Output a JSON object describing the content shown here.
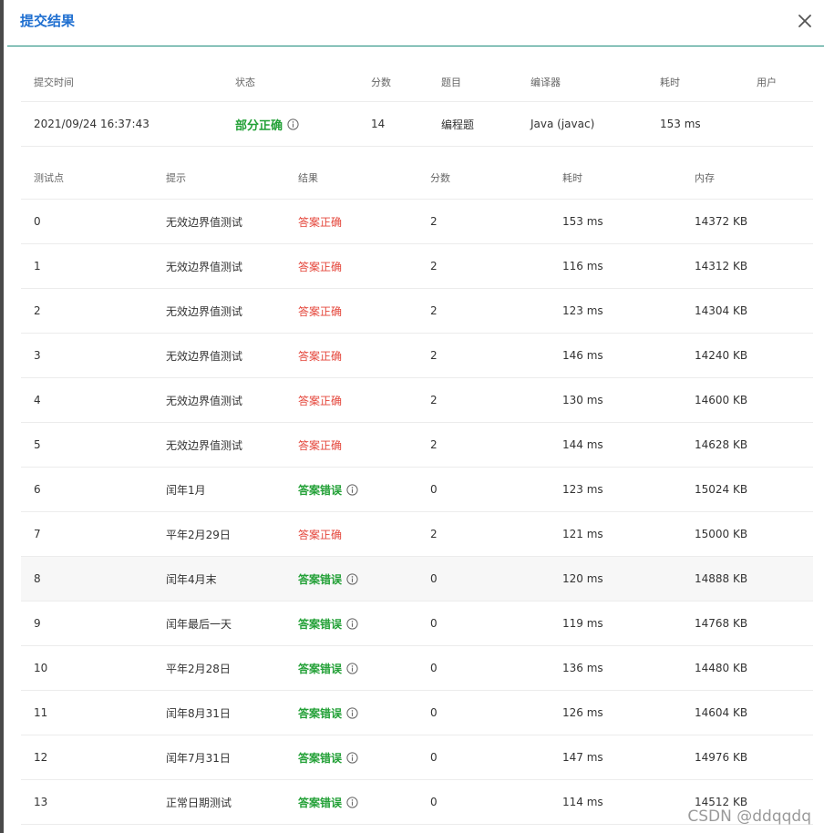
{
  "dialog": {
    "title": "提交结果"
  },
  "summary": {
    "headers": [
      "提交时间",
      "状态",
      "分数",
      "题目",
      "编译器",
      "耗时",
      "用户"
    ],
    "row": {
      "time": "2021/09/24 16:37:43",
      "status": "部分正确",
      "score": "14",
      "problem": "编程题",
      "compiler": "Java (javac)",
      "duration": "153 ms",
      "user": ""
    }
  },
  "tests": {
    "headers": [
      "测试点",
      "提示",
      "结果",
      "分数",
      "耗时",
      "内存"
    ],
    "rows": [
      {
        "id": "0",
        "hint": "无效边界值测试",
        "result": "答案正确",
        "ok": true,
        "score": "2",
        "time": "153 ms",
        "mem": "14372 KB"
      },
      {
        "id": "1",
        "hint": "无效边界值测试",
        "result": "答案正确",
        "ok": true,
        "score": "2",
        "time": "116 ms",
        "mem": "14312 KB"
      },
      {
        "id": "2",
        "hint": "无效边界值测试",
        "result": "答案正确",
        "ok": true,
        "score": "2",
        "time": "123 ms",
        "mem": "14304 KB"
      },
      {
        "id": "3",
        "hint": "无效边界值测试",
        "result": "答案正确",
        "ok": true,
        "score": "2",
        "time": "146 ms",
        "mem": "14240 KB"
      },
      {
        "id": "4",
        "hint": "无效边界值测试",
        "result": "答案正确",
        "ok": true,
        "score": "2",
        "time": "130 ms",
        "mem": "14600 KB"
      },
      {
        "id": "5",
        "hint": "无效边界值测试",
        "result": "答案正确",
        "ok": true,
        "score": "2",
        "time": "144 ms",
        "mem": "14628 KB"
      },
      {
        "id": "6",
        "hint": "闰年1月",
        "result": "答案错误",
        "ok": false,
        "score": "0",
        "time": "123 ms",
        "mem": "15024 KB"
      },
      {
        "id": "7",
        "hint": "平年2月29日",
        "result": "答案正确",
        "ok": true,
        "score": "2",
        "time": "121 ms",
        "mem": "15000 KB"
      },
      {
        "id": "8",
        "hint": "闰年4月末",
        "result": "答案错误",
        "ok": false,
        "score": "0",
        "time": "120 ms",
        "mem": "14888 KB"
      },
      {
        "id": "9",
        "hint": "闰年最后一天",
        "result": "答案错误",
        "ok": false,
        "score": "0",
        "time": "119 ms",
        "mem": "14768 KB"
      },
      {
        "id": "10",
        "hint": "平年2月28日",
        "result": "答案错误",
        "ok": false,
        "score": "0",
        "time": "136 ms",
        "mem": "14480 KB"
      },
      {
        "id": "11",
        "hint": "闰年8月31日",
        "result": "答案错误",
        "ok": false,
        "score": "0",
        "time": "126 ms",
        "mem": "14604 KB"
      },
      {
        "id": "12",
        "hint": "闰年7月31日",
        "result": "答案错误",
        "ok": false,
        "score": "0",
        "time": "147 ms",
        "mem": "14976 KB"
      },
      {
        "id": "13",
        "hint": "正常日期测试",
        "result": "答案错误",
        "ok": false,
        "score": "0",
        "time": "114 ms",
        "mem": "14512 KB"
      }
    ]
  },
  "watermark": "CSDN @ddqqdq",
  "colors": {
    "accent": "#1f6fd0",
    "correct_text": "#e4453a",
    "wrong_text": "#22a036",
    "header_rule": "#1a8a7a"
  }
}
